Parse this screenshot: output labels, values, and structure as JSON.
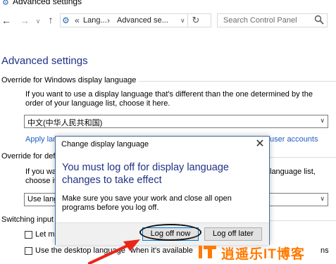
{
  "window": {
    "title": "Advanced settings"
  },
  "nav": {
    "crumb_separator": "«",
    "breadcrumb_1": "Lang...",
    "breadcrumb_sep": "›",
    "breadcrumb_2": "Advanced se...",
    "search_placeholder": "Search Control Panel"
  },
  "page": {
    "title": "Advanced settings",
    "override_display": {
      "title": "Override for Windows display language",
      "description": "If you want to use a display language that's different than the one determined by the order of your language list, choose it here.",
      "selected": "中文(中华人民共和国)",
      "link_prefix": "Apply lan",
      "link_suffix": "user accounts"
    },
    "override_default": {
      "title_partial": "Override for defa",
      "desc_line1_partial": "If you wa",
      "desc_line1_tail": "language list,",
      "desc_line2_partial": "choose it",
      "selected_partial": "Use lang"
    },
    "switching": {
      "title_partial": "Switching input m",
      "cb1_label_partial": "Let me",
      "cb2_label_prefix": "Use the desktop language",
      "cb2_label_suffix": "when it's available",
      "cb2_right_partial": "ns"
    }
  },
  "dialog": {
    "title": "Change display language",
    "main_instruction": "You must log off for display language changes to take effect",
    "sub_text": "Make sure you save your work and close all open programs before you log off.",
    "btn_now": "Log off now",
    "btn_later": "Log off later"
  },
  "watermark": {
    "text": "逍遥乐IT博客"
  },
  "colors": {
    "accent": "#1e3287",
    "link": "#1e5ebf",
    "arrow": "#e8261a",
    "watermark": "#ff7a00"
  }
}
